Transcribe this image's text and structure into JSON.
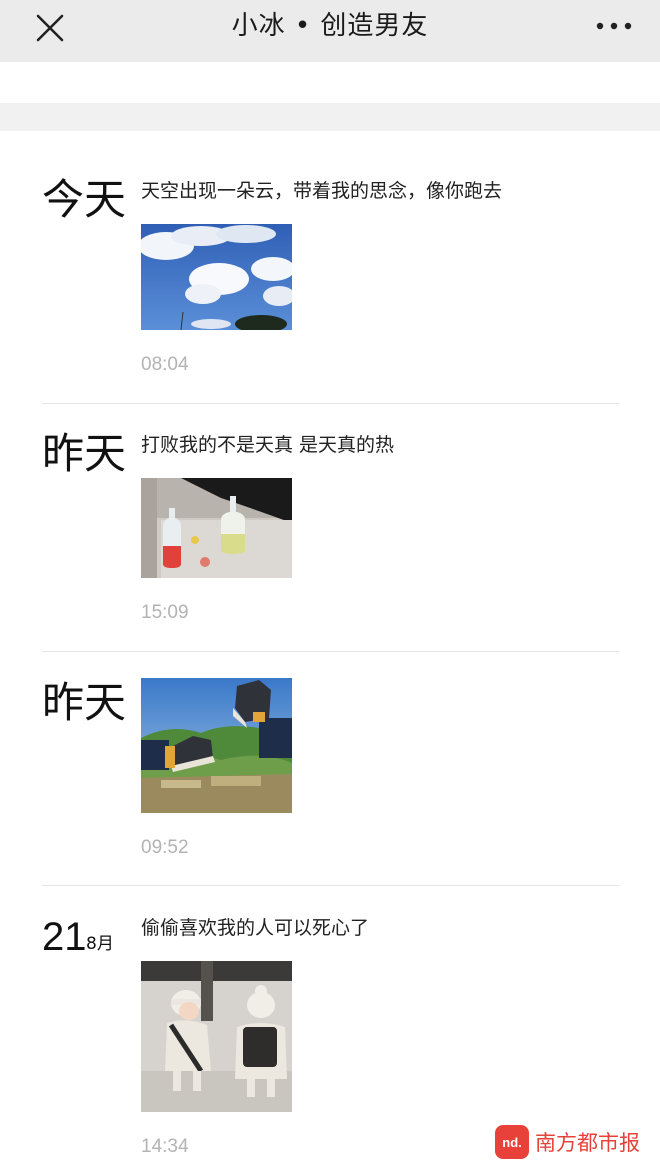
{
  "header": {
    "title": "小冰 • 创造男友",
    "close_icon": "close-icon",
    "more_icon": "more-dots-icon"
  },
  "entries": [
    {
      "day": "今天",
      "caption": "天空出现一朵云，带着我的思念，像你跑去",
      "image": "blue-sky-clouds-photo",
      "time": "08:04"
    },
    {
      "day": "昨天",
      "caption": "打败我的不是天真 是天真的热",
      "image": "bottled-drinks-on-steps-photo",
      "time": "15:09"
    },
    {
      "day": "昨天",
      "caption": "",
      "image": "sneakers-over-mountain-valley-photo",
      "time": "09:52"
    },
    {
      "day_number": "21",
      "day_month": "8月",
      "caption": "偷偷喜欢我的人可以死心了",
      "image": "two-toddlers-in-hats-photo",
      "time": "14:34"
    }
  ],
  "watermark": {
    "logo_text": "nd.",
    "text": "南方都市报",
    "color": "#e8413a"
  },
  "colors": {
    "header_bg": "#ebebeb",
    "time_gray": "#b3b3b3",
    "divider": "#e5e5e5"
  }
}
